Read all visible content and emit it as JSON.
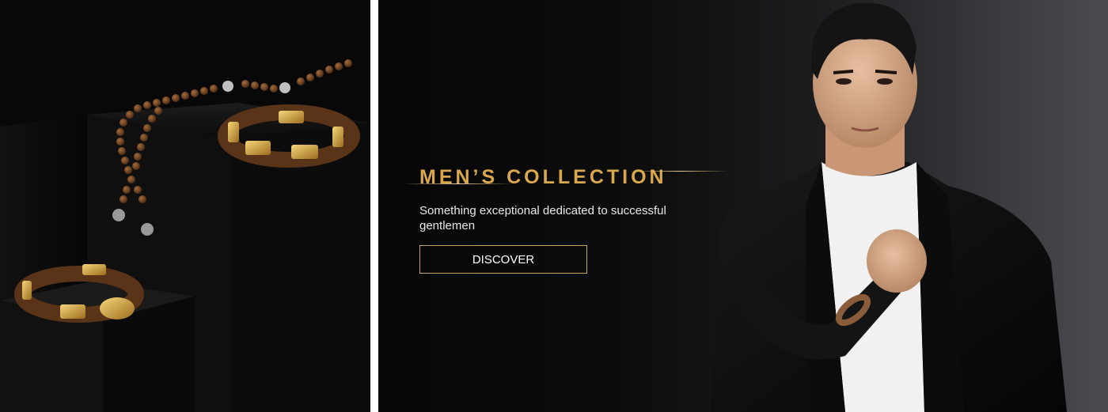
{
  "banner": {
    "title": "MEN’S COLLECTION",
    "subtitle": "Something exceptional dedicated to successful gentlemen",
    "cta_label": "DISCOVER"
  },
  "colors": {
    "accent_gold": "#d9a74e",
    "button_border": "#c9a35a",
    "text_light": "#e8e8e8",
    "background_dark": "#0a0a0a"
  },
  "images": {
    "left": "jewelry-product-photo",
    "right": "male-model-photo"
  }
}
